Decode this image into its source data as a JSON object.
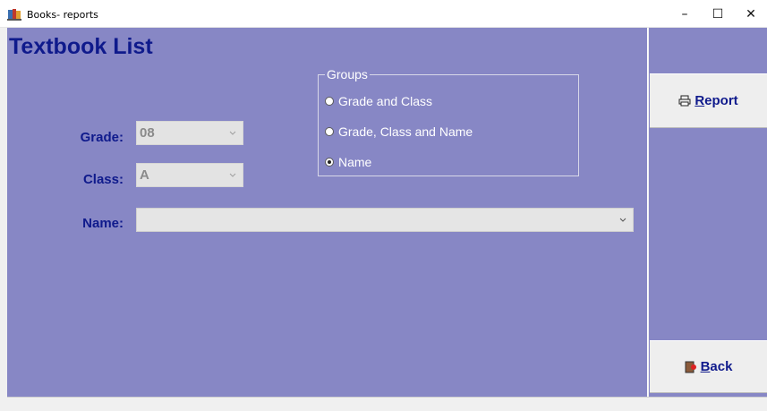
{
  "window": {
    "title": "Books- reports",
    "controls": {
      "minimize": "–",
      "maximize": "☐",
      "close": "✕"
    }
  },
  "page": {
    "title": "Textbook List"
  },
  "form": {
    "grade": {
      "label": "Grade:",
      "value": "08"
    },
    "class": {
      "label": "Class:",
      "value": "A"
    },
    "name": {
      "label": "Name:",
      "value": ""
    }
  },
  "groups": {
    "legend": "Groups",
    "options": [
      {
        "label": "Grade and Class",
        "checked": false
      },
      {
        "label": "Grade, Class and Name",
        "checked": false
      },
      {
        "label": "Name",
        "checked": true
      }
    ]
  },
  "buttons": {
    "report": {
      "first": "R",
      "rest": "eport",
      "icon": "printer-icon"
    },
    "back": {
      "first": "B",
      "rest": "ack",
      "icon": "exit-icon"
    }
  },
  "colors": {
    "panel": "#8787c5",
    "label": "#0f1a8c"
  }
}
